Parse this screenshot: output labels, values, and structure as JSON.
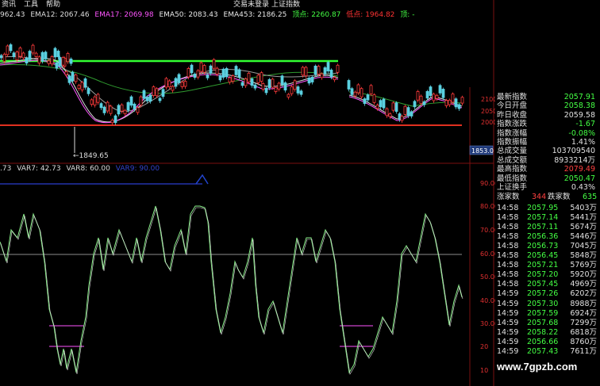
{
  "menu": {
    "items": [
      "资讯",
      "工具",
      "帮助"
    ],
    "login": "交易未登录",
    "index": "上证指数"
  },
  "ema": {
    "ema1": "962.43",
    "ema12": "EMA12: 2067.46",
    "ema17": "EMA17: 2069.98",
    "ema50": "EMA50: 2083.43",
    "ema453": "EMA453: 2186.25",
    "top": "顶点: 2260.87",
    "bottom": "低点: 1964.82",
    "top2": "顶: -"
  },
  "var": {
    "v1": ".73",
    "var7": "VAR7: 42.73",
    "var8": "VAR8: 60.00",
    "var9": "VAR9: 90.00"
  },
  "annotations": {
    "low_marker": "1849.65",
    "price_box": "1853.0"
  },
  "axes": {
    "upper": [
      "2100",
      "2050",
      "2000"
    ],
    "lower": [
      "90.00",
      "80.00",
      "70.00",
      "60.00",
      "50.00",
      "40.00",
      "30.00",
      "20",
      "10"
    ]
  },
  "quote_panel": [
    {
      "label": "最新指数",
      "value": "2057.91",
      "color": "#44ff44"
    },
    {
      "label": "今日开盘",
      "value": "2058.38",
      "color": "#44ff44"
    },
    {
      "label": "昨日收盘",
      "value": "2059.58",
      "color": "#e0e0e0"
    },
    {
      "label": "指数涨跌",
      "value": "-1.67",
      "color": "#44ff44"
    },
    {
      "label": "指数涨幅",
      "value": "-0.08%",
      "color": "#44ff44"
    },
    {
      "label": "指数振幅",
      "value": "1.41%",
      "color": "#e0e0e0"
    },
    {
      "label": "总成交量",
      "value": "103709540",
      "color": "#e0e0e0"
    },
    {
      "label": "总成交额",
      "value": "8933214万",
      "color": "#e0e0e0"
    },
    {
      "label": "最高指数",
      "value": "2079.49",
      "color": "#ff4040"
    },
    {
      "label": "最低指数",
      "value": "2050.47",
      "color": "#44ff44"
    },
    {
      "label": "上证换手",
      "value": "0.43%",
      "color": "#e0e0e0"
    }
  ],
  "breadth": {
    "up_label": "涨家数",
    "up": "344",
    "down_label": "跌家数",
    "down": "635"
  },
  "ticks": [
    {
      "time": "14:58",
      "price": "2057.95",
      "amount": "5403万"
    },
    {
      "time": "14:58",
      "price": "2057.14",
      "amount": "5441万"
    },
    {
      "time": "14:58",
      "price": "2057.11",
      "amount": "5674万"
    },
    {
      "time": "14:58",
      "price": "2056.36",
      "amount": "5446万"
    },
    {
      "time": "14:58",
      "price": "2056.73",
      "amount": "7045万"
    },
    {
      "time": "14:58",
      "price": "2056.45",
      "amount": "5848万"
    },
    {
      "time": "14:58",
      "price": "2057.21",
      "amount": "5769万"
    },
    {
      "time": "14:58",
      "price": "2057.20",
      "amount": "5920万"
    },
    {
      "time": "14:58",
      "price": "2057.45",
      "amount": "4969万"
    },
    {
      "time": "14:59",
      "price": "2057.26",
      "amount": "6202万"
    },
    {
      "time": "14:59",
      "price": "2057.30",
      "amount": "8988万"
    },
    {
      "time": "14:59",
      "price": "2057.59",
      "amount": "6924万"
    },
    {
      "time": "14:59",
      "price": "2057.68",
      "amount": "7299万"
    },
    {
      "time": "14:59",
      "price": "2058.22",
      "amount": "6818万"
    },
    {
      "time": "14:59",
      "price": "2056.66",
      "amount": "8760万"
    },
    {
      "time": "14:59",
      "price": "2057.43",
      "amount": "7611万"
    }
  ],
  "watermark": "www.7gpzb.com"
}
